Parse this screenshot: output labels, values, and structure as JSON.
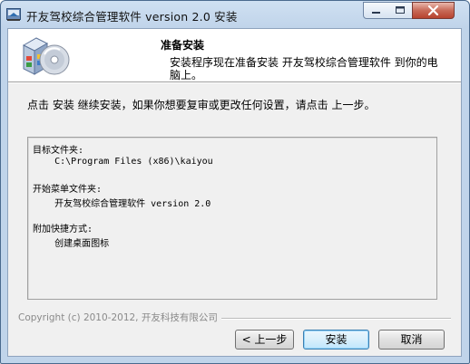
{
  "window": {
    "title": "开友驾校综合管理软件 version 2.0 安装"
  },
  "header": {
    "title": "准备安装",
    "subtitle": "安装程序现在准备安装 开友驾校综合管理软件 到你的电脑上。"
  },
  "main": {
    "instruction": "点击 安装 继续安装，如果你想要复审或更改任何设置，请点击 上一步。",
    "memo_lines": [
      "目标文件夹:",
      "    C:\\Program Files (x86)\\kaiyou",
      "开始菜单文件夹:",
      "    开友驾校综合管理软件 version 2.0",
      "附加快捷方式:",
      "    创建桌面图标"
    ]
  },
  "footer": {
    "copyright": "Copyright (c) 2010-2012, 开友科技有限公司"
  },
  "buttons": {
    "back": "< 上一步",
    "install": "安装",
    "cancel": "取消"
  },
  "icons": {
    "app": "installer-app-icon",
    "header": "package-disc-icon",
    "minimize": "minimize-icon",
    "maximize": "maximize-icon",
    "close": "close-icon"
  }
}
